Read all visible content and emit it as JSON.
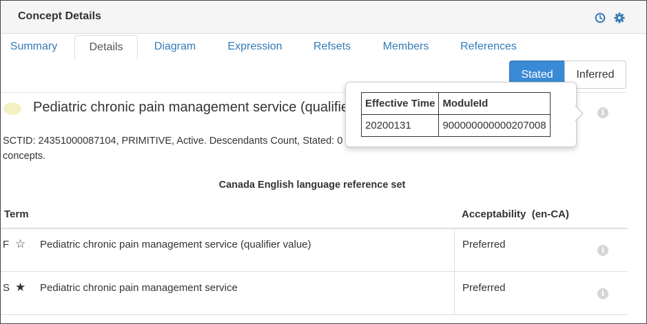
{
  "panel": {
    "title": "Concept Details",
    "history_icon": "history-icon",
    "settings_icon": "gear-icon"
  },
  "tabs": [
    {
      "label": "Summary"
    },
    {
      "label": "Details"
    },
    {
      "label": "Diagram"
    },
    {
      "label": "Expression"
    },
    {
      "label": "Refsets"
    },
    {
      "label": "Members"
    },
    {
      "label": "References"
    }
  ],
  "active_tab": "Details",
  "view_toggle": {
    "stated_label": "Stated",
    "inferred_label": "Inferred",
    "selected": "Stated"
  },
  "concept": {
    "title": "Pediatric chronic pain management service (qualifier value)",
    "info_line": "SCTID: 24351000087104, PRIMITIVE, Active. Descendants Count, Stated: 0 concepts."
  },
  "popover": {
    "headers": [
      "Effective Time",
      "ModuleId"
    ],
    "row": [
      "20200131",
      "900000000000207008"
    ]
  },
  "refset": {
    "title": "Canada English language reference set",
    "columns": {
      "term": "Term",
      "acceptability": "Acceptability  (en-CA)"
    },
    "rows": [
      {
        "type": "F",
        "star": "☆",
        "term": "Pediatric chronic pain management service (qualifier value)",
        "acceptability": "Preferred"
      },
      {
        "type": "S",
        "star": "★",
        "term": "Pediatric chronic pain management service",
        "acceptability": "Preferred"
      }
    ]
  },
  "colors": {
    "accent": "#3a8ad6",
    "link": "#337ab7",
    "concept_dot": "#f5f0c4"
  }
}
